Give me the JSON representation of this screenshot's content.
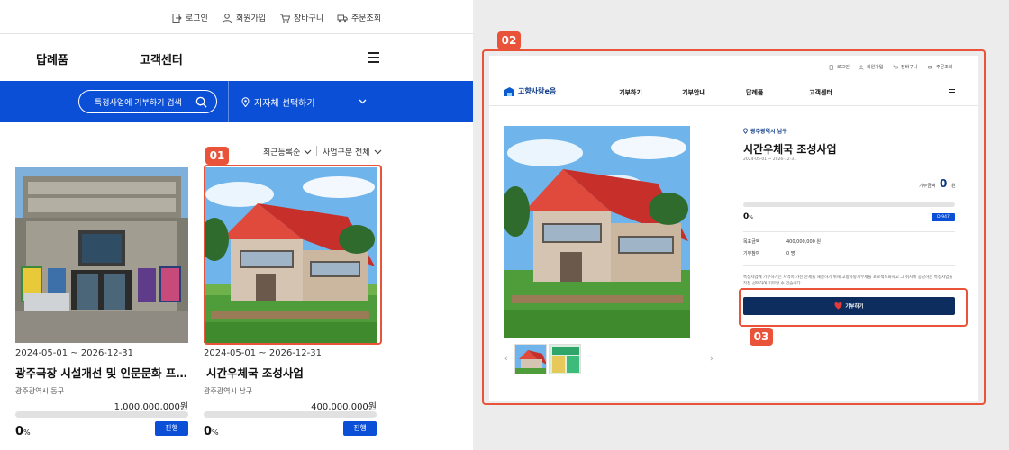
{
  "mobile": {
    "util_links": [
      {
        "label": "로그인",
        "icon": "login-icon"
      },
      {
        "label": "회원가입",
        "icon": "user-icon"
      },
      {
        "label": "장바구니",
        "icon": "cart-icon"
      },
      {
        "label": "주문조회",
        "icon": "truck-icon"
      }
    ],
    "nav": [
      "답례품",
      "고객센터"
    ],
    "search_placeholder": "특정사업에 기부하기 검색",
    "region_select": "지자체 선택하기",
    "sort": "최근등록순",
    "category": "사업구분 전체",
    "cards": [
      {
        "date": "2024-05-01 ~ 2026-12-31",
        "title": "광주극장 시설개선 및 인문문화 프…",
        "region": "광주광역시 동구",
        "amount": "1,000,000,000원",
        "percent": "0",
        "percent_unit": "%",
        "status": "진행",
        "progress": 0
      },
      {
        "date": "2024-05-01 ~ 2026-12-31",
        "title": "시간우체국 조성사업",
        "region": "광주광역시 남구",
        "amount": "400,000,000원",
        "percent": "0",
        "percent_unit": "%",
        "status": "진행",
        "progress": 0
      }
    ]
  },
  "callouts": [
    "01",
    "02",
    "03"
  ],
  "desktop": {
    "util_links": [
      {
        "label": "로그인",
        "icon": "login-icon"
      },
      {
        "label": "회원가입",
        "icon": "user-icon"
      },
      {
        "label": "장바구니",
        "icon": "cart-icon"
      },
      {
        "label": "주문조회",
        "icon": "truck-icon"
      }
    ],
    "logo": "고향사랑e음",
    "nav": [
      "기부하기",
      "기부안내",
      "답례품",
      "고객센터"
    ],
    "region": "광주광역시 남구",
    "title": "시간우체국 조성사업",
    "date": "2024-05-01 ~ 2026-12-31",
    "raised_label": "기부금액",
    "raised_value": "0",
    "raised_unit": "원",
    "percent": "0",
    "percent_unit": "%",
    "dday": "D-947",
    "goal_label": "목표금액",
    "goal_value": "400,000,000 원",
    "donors_label": "기부참여",
    "donors_value": "0 명",
    "notice": "특정사업에 기부하기는 지역이 가진 문제를 해결하기 위해 고향사랑기부제를 포로젝트화하고 그 취지에 공감하는 특정사업을 직접 선택하여 기부할 수 있습니다.",
    "donate_button": "기부하기",
    "progress": 0
  },
  "colors": {
    "accent_blue": "#0b4fd7",
    "navy": "#0c2d5e",
    "callout_red": "#e9533a"
  }
}
